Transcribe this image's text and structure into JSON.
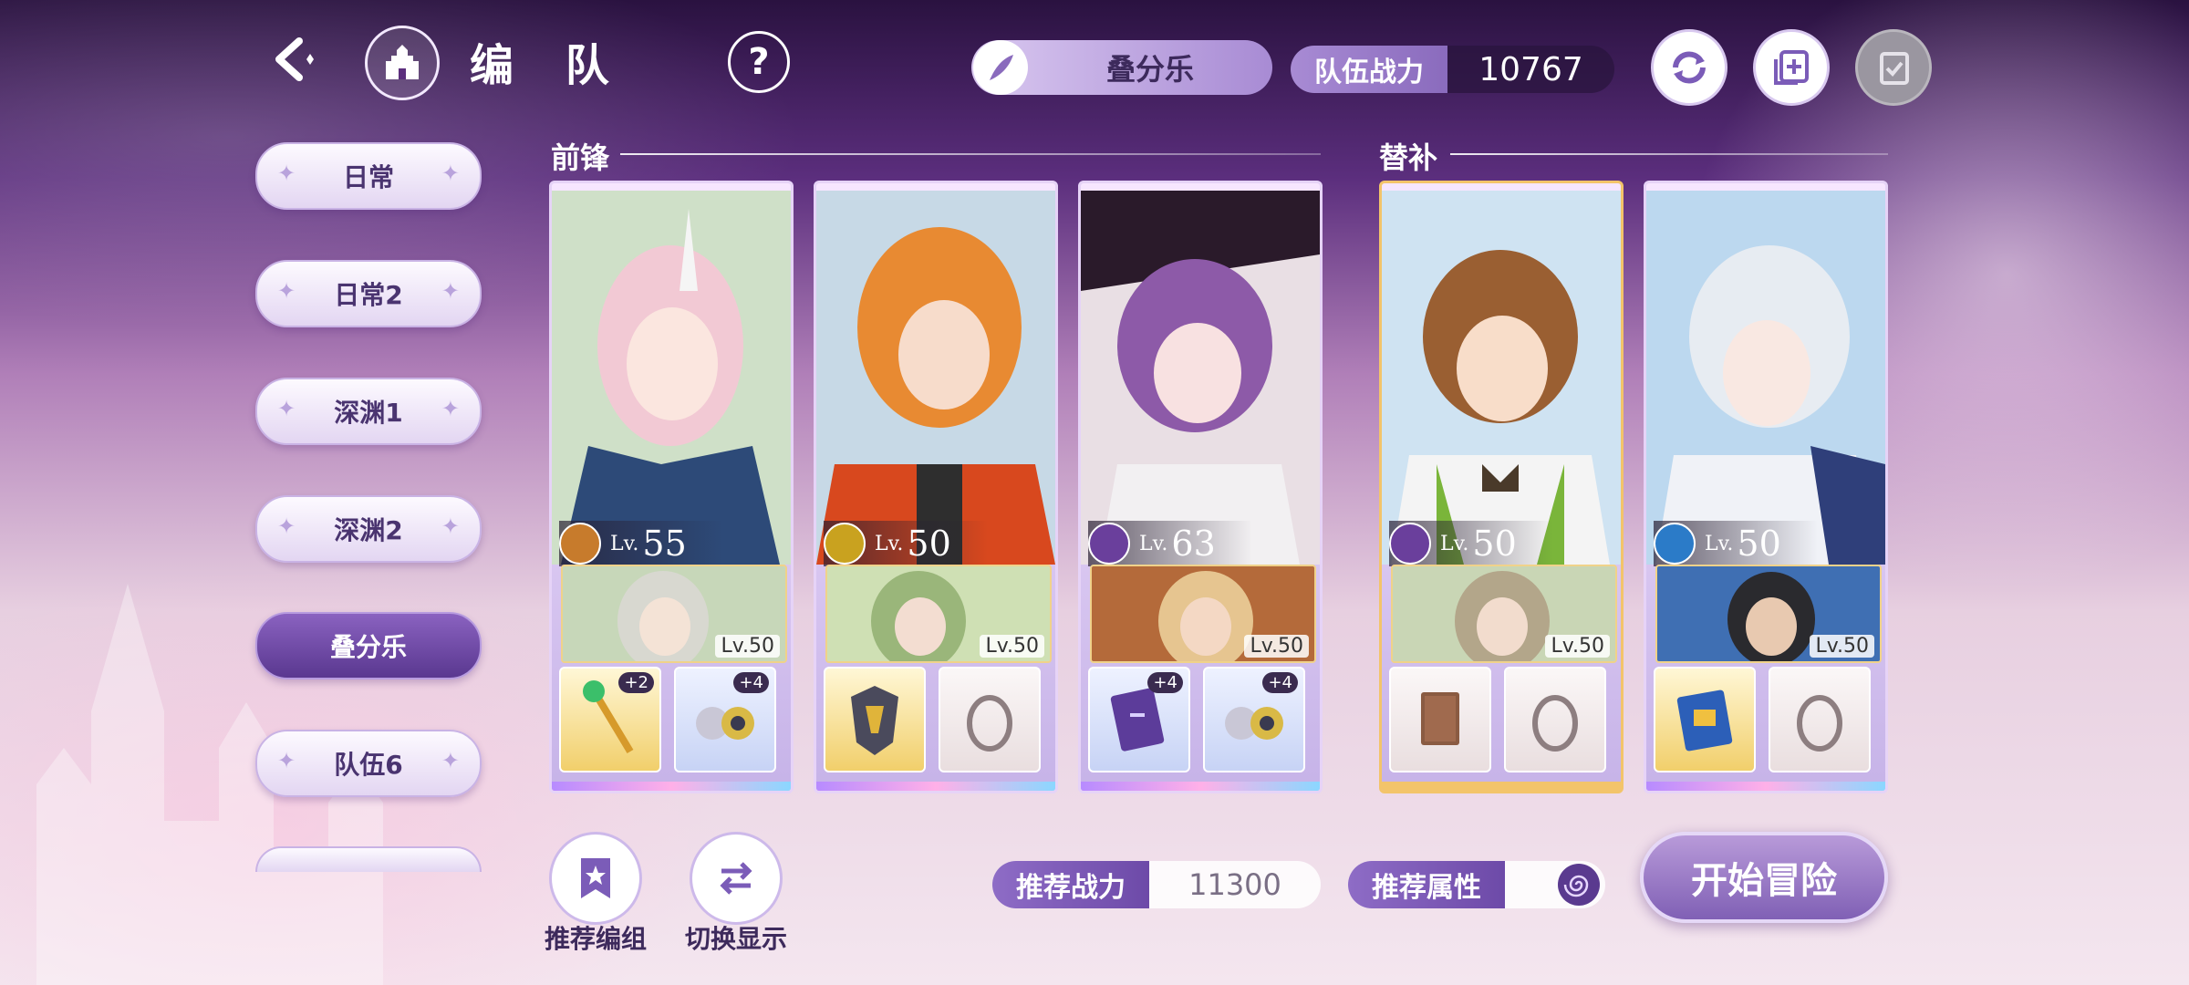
{
  "header": {
    "title": "编 队",
    "team_name": "叠分乐",
    "team_power_label": "队伍战力",
    "team_power_value": "10767"
  },
  "sidebar": {
    "items": [
      {
        "label": "日常",
        "active": false
      },
      {
        "label": "日常2",
        "active": false
      },
      {
        "label": "深渊1",
        "active": false
      },
      {
        "label": "深渊2",
        "active": false
      },
      {
        "label": "叠分乐",
        "active": true
      },
      {
        "label": "队伍6",
        "active": false
      }
    ]
  },
  "sections": {
    "front": "前锋",
    "bench": "替补"
  },
  "cards": [
    {
      "level_prefix": "Lv.",
      "level": "55",
      "element": "orange",
      "sub_level": "Lv.50",
      "equip_left": "staff",
      "equip_left_plus": "+2",
      "equip_right": "bells",
      "equip_right_plus": "+4"
    },
    {
      "level_prefix": "Lv.",
      "level": "50",
      "element": "gold",
      "sub_level": "Lv.50",
      "equip_left": "helmet",
      "equip_left_plus": "",
      "equip_right": "ring-empty",
      "equip_right_plus": ""
    },
    {
      "level_prefix": "Lv.",
      "level": "63",
      "element": "purple",
      "sub_level": "Lv.50",
      "equip_left": "book",
      "equip_left_plus": "+4",
      "equip_right": "bells",
      "equip_right_plus": "+4"
    },
    {
      "level_prefix": "Lv.",
      "level": "50",
      "element": "purple",
      "sub_level": "Lv.50",
      "equip_left": "book-empty",
      "equip_left_plus": "",
      "equip_right": "ring-empty",
      "equip_right_plus": ""
    },
    {
      "level_prefix": "Lv.",
      "level": "50",
      "element": "blue",
      "sub_level": "Lv.50",
      "equip_left": "tome",
      "equip_left_plus": "",
      "equip_right": "ring-empty",
      "equip_right_plus": ""
    }
  ],
  "bottom": {
    "recommend_team_label": "推荐编组",
    "switch_display_label": "切换显示",
    "recommended_power_label": "推荐战力",
    "recommended_power_value": "11300",
    "recommended_attr_label": "推荐属性",
    "start_label": "开始冒险"
  },
  "colors": {
    "accent": "#8a62c0",
    "gold_frame": "#f3c46a"
  }
}
